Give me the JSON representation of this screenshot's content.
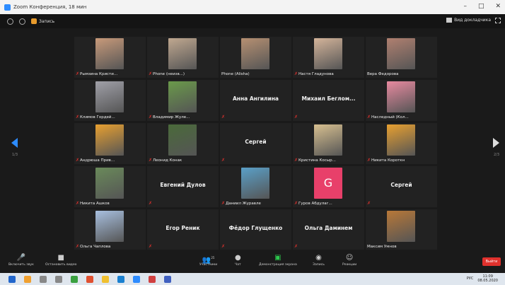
{
  "window": {
    "title": "Zoom Конференция, 18 мин",
    "controls": [
      "–",
      "□",
      "✕"
    ]
  },
  "topbar": {
    "record_label": "Запись",
    "view_label": "Вид докладчика"
  },
  "pager": {
    "left": "1/3",
    "right": "2/3"
  },
  "tiles": [
    {
      "name": "Рымзина Кристи...",
      "muted": true,
      "photo": "#c89a7a"
    },
    {
      "name": "Phone (неизв...)",
      "muted": true,
      "photo": "#c0a890"
    },
    {
      "name": "Phone (Alisha)",
      "muted": false,
      "photo": "#b69072"
    },
    {
      "name": "Настя Гладунова",
      "muted": true,
      "photo": "#d4b49a"
    },
    {
      "name": "Вера Федорова",
      "muted": false,
      "photo": "#b08070"
    },
    {
      "name": "Климов Гордей...",
      "muted": true,
      "photo": "#a0a0a8"
    },
    {
      "name": "Владимир Жуле...",
      "muted": true,
      "photo": "#6a9a4a"
    },
    {
      "name": "Анна Ангилина",
      "muted": true,
      "center": true
    },
    {
      "name": "Михаил Беглом...",
      "muted": true,
      "center": true
    },
    {
      "name": "Наследный (Кол...",
      "muted": true,
      "photo": "#e88aa0"
    },
    {
      "name": "Андрюша Прив...",
      "muted": true,
      "photo": "#e8a030"
    },
    {
      "name": "Леонид Конак",
      "muted": true,
      "photo": "#4a6a3a"
    },
    {
      "name": "Сергей",
      "muted": true,
      "center": true
    },
    {
      "name": "Кристина Косыр...",
      "muted": true,
      "photo": "#d8c090"
    },
    {
      "name": "Никита Короткн",
      "muted": true,
      "photo": "#e8a030"
    },
    {
      "name": "Никита Ашков",
      "muted": true,
      "photo": "#6a8a5a"
    },
    {
      "name": "Евгений Дулов",
      "muted": true,
      "center": true
    },
    {
      "name": "Даниил Журавле",
      "muted": true,
      "photo": "#5aa0c8"
    },
    {
      "name": "Гуров Абдулаг...",
      "muted": true,
      "avatar": "G"
    },
    {
      "name": "Сергей",
      "muted": true,
      "center": true
    },
    {
      "name": "Ольга Чаплова",
      "muted": true,
      "photo": "#a8c0e0"
    },
    {
      "name": "Егор Реник",
      "muted": true,
      "center": true
    },
    {
      "name": "Фёдор Глущенко",
      "muted": true,
      "center": true
    },
    {
      "name": "Ольга Даминем",
      "muted": true,
      "center": true
    },
    {
      "name": "Максим Умнов",
      "muted": false,
      "photo": "#b87838"
    }
  ],
  "toolbar": {
    "mic": "Включить звук",
    "video": "Остановить видео",
    "participants": "Участники",
    "participants_count": "25",
    "chat": "Чат",
    "share": "Демонстрация экрана",
    "record": "Запись",
    "reactions": "Реакции",
    "end": "Выйти"
  },
  "tray": {
    "lang": "РУС",
    "time": "11:09",
    "date": "08.05.2020"
  }
}
